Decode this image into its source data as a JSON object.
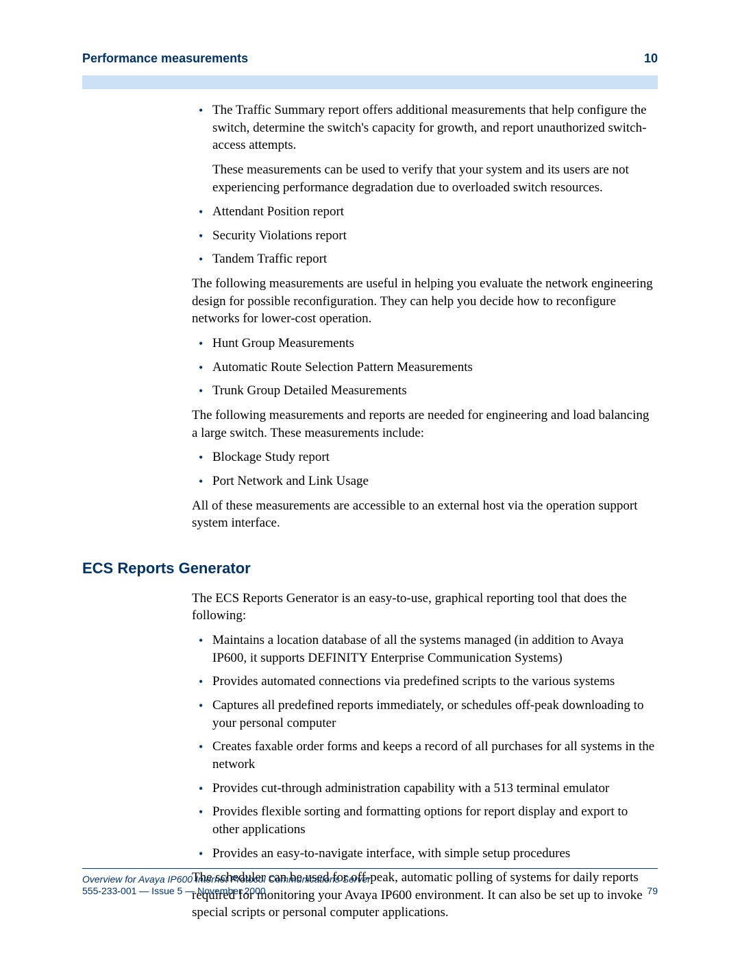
{
  "header": {
    "title": "Performance measurements",
    "chapter": "10"
  },
  "section1": {
    "bullets1": [
      {
        "main": "The Traffic Summary report offers additional measurements that help configure the switch, determine the switch's capacity for growth, and report unauthorized switch-access attempts.",
        "sub": "These measurements can be used to verify that your system and its users are not experiencing performance degradation due to overloaded switch resources."
      },
      {
        "main": "Attendant Position report"
      },
      {
        "main": "Security Violations report"
      },
      {
        "main": "Tandem Traffic report"
      }
    ],
    "para1": "The following measurements are useful in helping you evaluate the network engineering design for possible reconfiguration. They can help you decide how to reconfigure networks for lower-cost operation.",
    "bullets2": [
      "Hunt Group Measurements",
      "Automatic Route Selection Pattern Measurements",
      "Trunk Group Detailed Measurements"
    ],
    "para2": "The following measurements and reports are needed for engineering and load balancing a large switch. These measurements include:",
    "bullets3": [
      "Blockage Study report",
      "Port Network and Link Usage"
    ],
    "para3": "All of these measurements are accessible to an external host via the operation support system interface."
  },
  "section2": {
    "heading": "ECS Reports Generator",
    "intro": "The ECS Reports Generator is an easy-to-use, graphical reporting tool that does the following:",
    "bullets": [
      "Maintains a location database of all the systems managed (in addition to Avaya IP600, it supports DEFINITY Enterprise Communication Systems)",
      "Provides automated connections via predefined scripts to the various systems",
      "Captures all predefined reports immediately, or schedules off-peak downloading to your personal computer",
      "Creates faxable order forms and keeps a record of all purchases for all systems in the network",
      "Provides cut-through administration capability with a 513 terminal emulator",
      "Provides flexible sorting and formatting options for report display and export to other applications",
      "Provides an easy-to-navigate interface, with simple setup procedures"
    ],
    "outro": "The scheduler can be used for off-peak, automatic polling of systems for daily reports required for monitoring your Avaya IP600 environment. It can also be set up to invoke special scripts or personal computer applications."
  },
  "footer": {
    "doc_title": "Overview for Avaya IP600 Internet Protocol Communications Server",
    "doc_info": "555-233-001 — Issue 5 — November 2000",
    "page_num": "79"
  }
}
